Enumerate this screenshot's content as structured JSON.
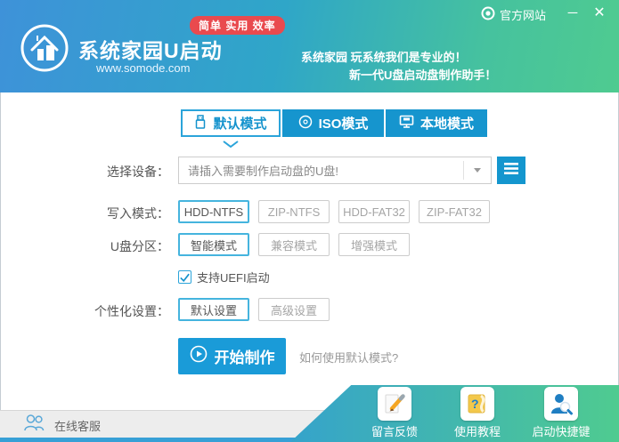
{
  "titlebar": {
    "official_site": "官方网站",
    "minimize": "─",
    "close": "✕"
  },
  "header": {
    "app_title": "系统家园U启动",
    "website": "www.somode.com",
    "badge": "简单 实用 效率",
    "tagline1": "系统家园 玩系统我们是专业的！",
    "tagline2": "新一代U盘启动盘制作助手！"
  },
  "tabs": [
    {
      "label": "默认模式",
      "icon": "usb-icon",
      "active": true
    },
    {
      "label": "ISO模式",
      "icon": "disc-icon",
      "active": false
    },
    {
      "label": "本地模式",
      "icon": "monitor-icon",
      "active": false
    }
  ],
  "form": {
    "device_label": "选择设备：",
    "device_placeholder": "请插入需要制作启动盘的U盘!",
    "write_mode_label": "写入模式：",
    "write_modes": [
      "HDD-NTFS",
      "ZIP-NTFS",
      "HDD-FAT32",
      "ZIP-FAT32"
    ],
    "write_mode_selected": "HDD-NTFS",
    "partition_label": "U盘分区：",
    "partitions": [
      "智能模式",
      "兼容模式",
      "增强模式"
    ],
    "partition_selected": "智能模式",
    "uefi_label": "支持UEFI启动",
    "uefi_checked": true,
    "personalize_label": "个性化设置：",
    "personalize_options": [
      "默认设置",
      "高级设置"
    ],
    "personalize_selected": "默认设置",
    "start_label": "开始制作",
    "help_link": "如何使用默认模式?"
  },
  "footer": {
    "online_service": "在线客服",
    "actions": [
      {
        "label": "留言反馈",
        "icon": "feedback-icon"
      },
      {
        "label": "使用教程",
        "icon": "tutorial-icon"
      },
      {
        "label": "启动快捷键",
        "icon": "hotkey-icon"
      }
    ]
  },
  "colors": {
    "tab_blue": "#1695ce",
    "selected_border": "#45b4de",
    "start_button": "#1a9bd8",
    "badge_red": "#e94a4e",
    "header_gradient_start": "#3e92d9",
    "header_gradient_end": "#4fcb90",
    "footer_gradient_start": "#35a3cb",
    "footer_gradient_end": "#4fcb90",
    "bottom_strip": "#38a0d6"
  }
}
